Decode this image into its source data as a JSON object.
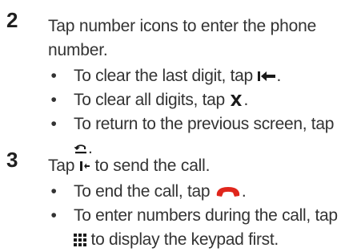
{
  "steps": [
    {
      "number": "2",
      "text": "Tap number icons to enter the phone number.",
      "bullets": [
        {
          "before": "To clear the last digit, tap",
          "icon": "backspace-icon",
          "after": "."
        },
        {
          "before": "To clear all digits, tap",
          "icon": "clear-x-icon",
          "after": "."
        },
        {
          "before": "To return to the previous screen, tap",
          "icon": "back-return-icon",
          "after": "."
        }
      ]
    },
    {
      "number": "3",
      "text_before": "Tap",
      "text_icon": "send-call-icon",
      "text_after": "to send the call.",
      "bullets": [
        {
          "before": "To end the call, tap",
          "icon": "end-call-handset-icon",
          "after": "."
        },
        {
          "before": "To enter numbers during the call, tap",
          "icon": "keypad-icon",
          "after": "to display the keypad first."
        }
      ]
    }
  ],
  "colors": {
    "text": "#333333",
    "end_call_red": "#e0261c",
    "icon_dark": "#1a1a1a"
  }
}
